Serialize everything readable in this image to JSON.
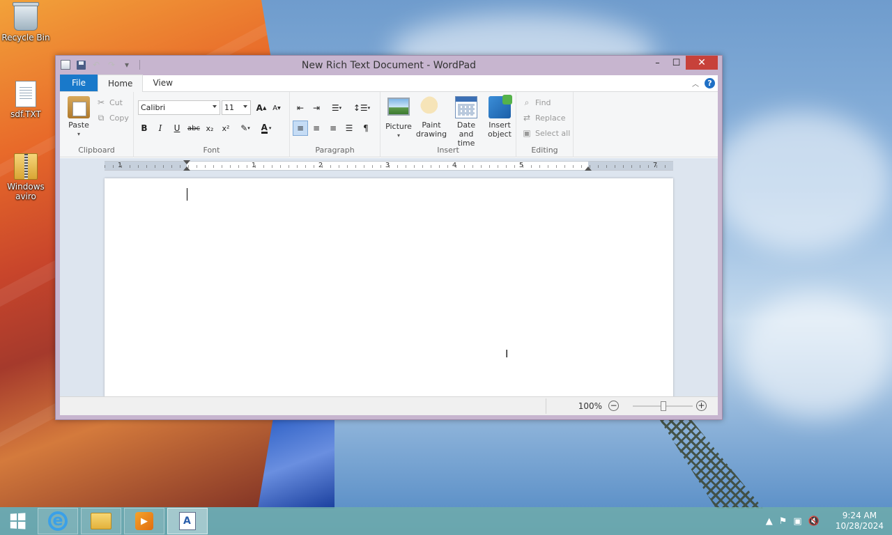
{
  "desktop": {
    "icons": [
      {
        "label": "Recycle Bin"
      },
      {
        "label": "sdf.TXT"
      },
      {
        "label": "Windows aviro"
      }
    ]
  },
  "window": {
    "title": "New Rich Text Document - WordPad",
    "controls": {
      "minimize": "–",
      "maximize": "☐",
      "close": "✕"
    }
  },
  "qat": {
    "customize": "▾"
  },
  "tabs": [
    {
      "label": "File"
    },
    {
      "label": "Home"
    },
    {
      "label": "View"
    }
  ],
  "ribbon": {
    "clipboard": {
      "group_label": "Clipboard",
      "paste": "Paste",
      "cut": "Cut",
      "copy": "Copy"
    },
    "font": {
      "group_label": "Font",
      "family": "Calibri",
      "size": "11",
      "grow": "A",
      "shrink": "A",
      "bold": "B",
      "italic": "I",
      "underline": "U",
      "strike": "abc",
      "subscript": "x₂",
      "superscript": "x²",
      "color": "A"
    },
    "paragraph": {
      "group_label": "Paragraph"
    },
    "insert": {
      "group_label": "Insert",
      "picture": "Picture",
      "paint_line1": "Paint",
      "paint_line2": "drawing",
      "date_line1": "Date and",
      "date_line2": "time",
      "object_line1": "Insert",
      "object_line2": "object"
    },
    "editing": {
      "group_label": "Editing",
      "find": "Find",
      "replace": "Replace",
      "select_all": "Select all"
    }
  },
  "ruler": {
    "labels": [
      "1",
      "1",
      "2",
      "3",
      "4",
      "5",
      "7"
    ]
  },
  "statusbar": {
    "zoom": "100%",
    "zoom_out": "−",
    "zoom_in": "+",
    "zoom_level": 0.5
  },
  "taskbar": {
    "clock_time": "9:24 AM",
    "clock_date": "10/28/2024"
  }
}
